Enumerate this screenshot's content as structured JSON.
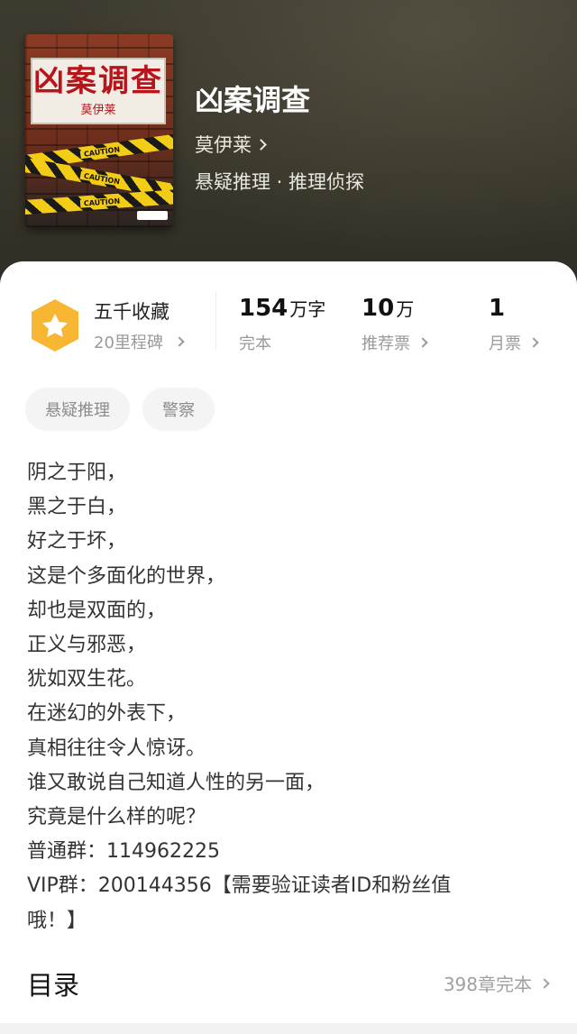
{
  "book": {
    "title": "凶案调查",
    "author": "莫伊莱",
    "genre": "悬疑推理 · 推理侦探"
  },
  "cover": {
    "title": "凶案调查",
    "author": "莫伊莱",
    "tape_text": [
      "CAUTION",
      "CAUTION",
      "CAUTION"
    ]
  },
  "milestone": {
    "title": "五千收藏",
    "sub": "20里程碑"
  },
  "stats": [
    {
      "num": "154",
      "unit": "万字",
      "label": "完本"
    },
    {
      "num": "10",
      "unit": "万",
      "label": "推荐票"
    },
    {
      "num": "1",
      "unit": "",
      "label": "月票"
    }
  ],
  "tags": [
    "悬疑推理",
    "警察"
  ],
  "intro": [
    "阴之于阳，",
    "黑之于白，",
    "好之于坏，",
    "这是个多面化的世界，",
    "却也是双面的，",
    "正义与邪恶，",
    "犹如双生花。",
    "在迷幻的外表下，",
    "真相往往令人惊讶。",
    "谁又敢说自己知道人性的另一面，",
    "究竟是什么样的呢？",
    "普通群：114962225",
    "VIP群：200144356【需要验证读者ID和粉丝值",
    "哦！】"
  ],
  "toc": {
    "title": "目录",
    "count": "398章完本"
  },
  "colors": {
    "badge": "#f7b733",
    "accent": "#111111",
    "muted": "#9a9a9a"
  }
}
